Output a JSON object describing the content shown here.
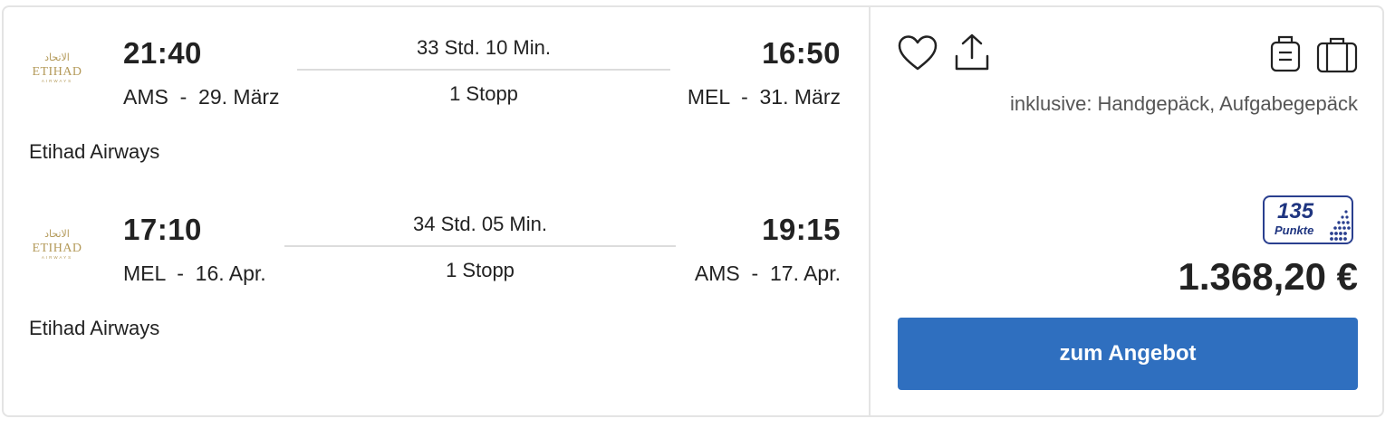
{
  "legs": [
    {
      "depart_time": "21:40",
      "depart_place": "AMS  -  29. März",
      "duration": "33 Std. 10 Min.",
      "stops": "1 Stopp",
      "arrive_time": "16:50",
      "arrive_place": "MEL  -  31. März",
      "airline": "Etihad Airways"
    },
    {
      "depart_time": "17:10",
      "depart_place": "MEL  -  16. Apr.",
      "duration": "34 Std. 05 Min.",
      "stops": "1 Stopp",
      "arrive_time": "19:15",
      "arrive_place": "AMS  -  17. Apr.",
      "airline": "Etihad Airways"
    }
  ],
  "logo": {
    "arabic": "الاتحاد",
    "wordmark": "ETIHAD",
    "sub": "AIRWAYS",
    "color": "#b49a5a"
  },
  "actions": {
    "favorite_icon": "heart-icon",
    "share_icon": "share-icon",
    "hand_luggage_icon": "hand-luggage-icon",
    "checked_luggage_icon": "suitcase-icon"
  },
  "baggage": {
    "inclusive_text": "inklusive: Handgepäck, Aufgabegepäck"
  },
  "points": {
    "value": "135",
    "label": "Punkte",
    "color": "#1f3580"
  },
  "price": "1.368,20 €",
  "cta_label": "zum Angebot",
  "colors": {
    "accent": "#2f6fbf",
    "border": "#e4e4e4"
  }
}
